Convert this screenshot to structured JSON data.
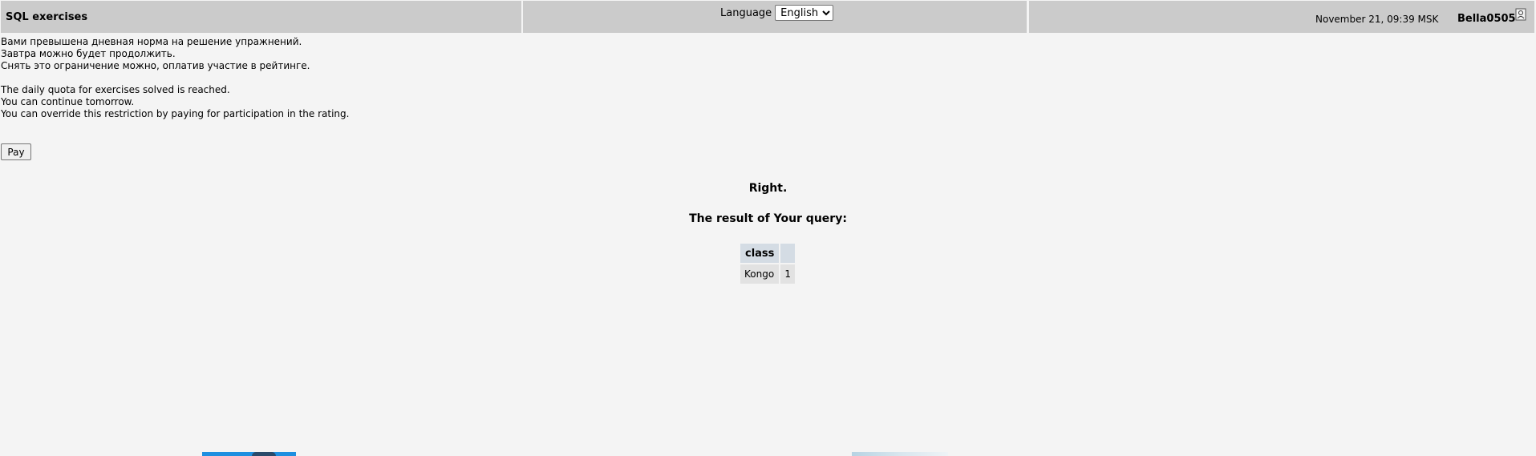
{
  "header": {
    "app_title": "SQL exercises",
    "language_label": "Language",
    "language_selected": "English",
    "datetime": "November 21, 09:39 MSK",
    "username": "Bella0505"
  },
  "quota_message": {
    "ru": [
      "Вами превышена дневная норма на решение упражнений.",
      "Завтра можно будет продолжить.",
      "Снять это ограничение можно, оплатив участие в рейтинге."
    ],
    "en": [
      "The daily quota for exercises solved is reached.",
      "You can continue tomorrow.",
      "You can override this restriction by paying for participation in the rating."
    ]
  },
  "pay_button_label": "Pay",
  "result": {
    "status": "Right.",
    "heading": "The result of Your query:",
    "columns": [
      "class",
      ""
    ],
    "rows": [
      [
        "Kongo",
        "1"
      ]
    ]
  },
  "icons": {
    "user_icon": "user-profile-icon"
  }
}
